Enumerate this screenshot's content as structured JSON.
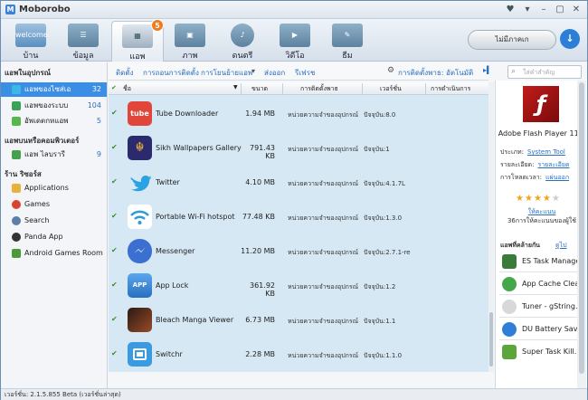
{
  "window": {
    "title": "Moborobo",
    "logo_letter": "M",
    "controls": [
      "♥",
      "▾",
      "–",
      "▢",
      "✕"
    ]
  },
  "toolbar": {
    "nav": [
      {
        "label": "บ้าน",
        "icon": "welcome-icon",
        "icon_text": "welcome",
        "color": "#5a8fc0"
      },
      {
        "label": "ข้อมูล",
        "icon": "contacts-icon",
        "icon_text": "",
        "color": "#4f7fa8"
      },
      {
        "label": "แอพ",
        "icon": "apps-icon",
        "icon_text": "",
        "color": "#8a9aa8",
        "badge": "5",
        "active": true
      },
      {
        "label": "ภาพ",
        "icon": "photos-icon",
        "icon_text": "",
        "color": "#5c7f9c"
      },
      {
        "label": "ดนตรี",
        "icon": "music-icon",
        "icon_text": "",
        "color": "#4a6f8f"
      },
      {
        "label": "วิดีโอ",
        "icon": "video-icon",
        "icon_text": "",
        "color": "#5a7a96"
      },
      {
        "label": "ธีม",
        "icon": "theme-icon",
        "icon_text": "",
        "color": "#6d8aa4"
      }
    ],
    "device_label": "ไม่มีภาคเก",
    "download_icon": "download-icon"
  },
  "sidebar": {
    "section1": "แอพในอุปกรณ์",
    "items": [
      {
        "label": "แอพของไซส่เอ",
        "count": "32",
        "color": "#3cb8e8",
        "active": true
      },
      {
        "label": "แอพของระบบ",
        "count": "104",
        "color": "#3aa35a"
      },
      {
        "label": "อัพเดตกหแอพ",
        "count": "5",
        "color": "#56b84b"
      }
    ],
    "section2": "แอพบนหรือคอมพิวเตอร์",
    "items2": [
      {
        "label": "แอพ ไลบรารี",
        "count": "9",
        "color": "#47a34b"
      }
    ],
    "section3": "ร้าน ริซอร์ส",
    "cats": [
      {
        "label": "Applications",
        "color": "#e8b13a"
      },
      {
        "label": "Games",
        "color": "#d9442f"
      },
      {
        "label": "Search",
        "color": "#5a7ea8"
      },
      {
        "label": "Panda App",
        "color": "#333333"
      },
      {
        "label": "Android Games Room",
        "color": "#4d9a3b"
      }
    ]
  },
  "subbar": {
    "links": [
      "ติดตั้ง",
      "การถอนการติดตั้ง",
      "การโยนย้ายแอพ",
      "ส่งออก",
      "รีเฟรช"
    ],
    "dropdown_arrow": "▾",
    "sort_label": "การติดตั้งพาธ: อัตโนมัติ",
    "search_placeholder": "ใส่คำสำคัญ"
  },
  "table": {
    "headers": [
      "ชื่อ",
      "ขนาด",
      "การติดตั้งพาธ",
      "เวอร์ชั่น",
      "การดำเนินการ"
    ],
    "rows": [
      {
        "name": "Tube Downloader",
        "size": "1.94 MB",
        "location": "หน่วยความจำของอุปกรณ์",
        "version": "ปัจจุบัน:8.0",
        "icon": "tube-downloader-icon",
        "icon_text": "tube",
        "color": "#e0473a"
      },
      {
        "name": "Sikh Wallpapers Gallery",
        "size": "791.43 KB",
        "location": "หน่วยความจำของอุปกรณ์",
        "version": "ปัจจุบัน:1",
        "icon": "sikh-wallpapers-icon",
        "icon_text": "☬",
        "color": "#2c2a6e"
      },
      {
        "name": "Twitter",
        "size": "4.10 MB",
        "location": "หน่วยความจำของอุปกรณ์",
        "version": "ปัจจุบัน:4.1.7L",
        "icon": "twitter-icon",
        "icon_text": "",
        "color": "#2aa3e2"
      },
      {
        "name": "Portable Wi-Fi hotspot",
        "size": "77.48 KB",
        "location": "หน่วยความจำของอุปกรณ์",
        "version": "ปัจจุบัน:1.3.0",
        "icon": "wifi-hotspot-icon",
        "icon_text": "",
        "color": "#2f9bd6"
      },
      {
        "name": "Messenger",
        "size": "11.20 MB",
        "location": "หน่วยความจำของอุปกรณ์",
        "version": "ปัจจุบัน:2.7.1-re",
        "icon": "messenger-icon",
        "icon_text": "",
        "color": "#3b6fd0"
      },
      {
        "name": "App Lock",
        "size": "361.92 KB",
        "location": "หน่วยความจำของอุปกรณ์",
        "version": "ปัจจุบัน:1.2",
        "icon": "app-lock-icon",
        "icon_text": "APP",
        "color": "#3b8fe0"
      },
      {
        "name": "Bleach Manga Viewer",
        "size": "6.73 MB",
        "location": "หน่วยความจำของอุปกรณ์",
        "version": "ปัจจุบัน:1.1",
        "icon": "bleach-manga-icon",
        "icon_text": "",
        "color": "#7a3a22"
      },
      {
        "name": "Switchr",
        "size": "2.28 MB",
        "location": "หน่วยความจำของอุปกรณ์",
        "version": "ปัจจุบัน:1.1.0",
        "icon": "switchr-icon",
        "icon_text": "",
        "color": "#3a9be0"
      }
    ]
  },
  "detail": {
    "app_name": "Adobe Flash Player 11.1",
    "type_label": "ประเภท:",
    "type_value": "System Tool",
    "detail_label": "รายละเอียด:",
    "detail_value": "รายละเอียด",
    "screens_label": "การโหลดเวลา:",
    "screens_value": "แผ่นออก",
    "rating": 4,
    "rating_max": 5,
    "rate_link": "ให้คะแนน",
    "rate_text": "36การให้คะแนนของผู้ใช้",
    "rec_title": "แอพที่คล้ายกัน",
    "rec_more": "ดูไป",
    "recs": [
      {
        "name": "ES Task Manager...",
        "color": "#3a7a3a"
      },
      {
        "name": "App Cache Clean...",
        "color": "#44a84a"
      },
      {
        "name": "Tuner - gString...",
        "color": "#cccccc"
      },
      {
        "name": "DU Battery Save...",
        "color": "#2f7fd6"
      },
      {
        "name": "Super Task Kill...",
        "color": "#5aa63a"
      }
    ]
  },
  "status": {
    "text": "เวอร์ชั่น: 2.1.5.855 Beta  (เวอร์ชั่นล่าสุด)"
  }
}
